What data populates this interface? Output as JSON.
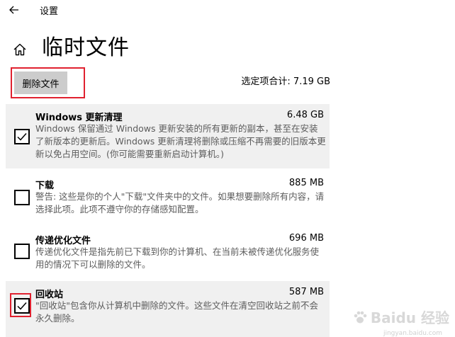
{
  "titlebar": {
    "app_title": "设置"
  },
  "page": {
    "title": "临时文件",
    "delete_button_label": "删除文件",
    "selected_total": "选定项合计: 7.19 GB"
  },
  "categories": [
    {
      "name": "Windows 更新清理",
      "size": "6.48 GB",
      "description": "Windows 保留通过 Windows 更新安装的所有更新的副本，甚至在安装了新版本的更新后。Windows 更新清理将删除或压缩不再需要的旧版本更新以免占用空间。(你可能需要重新启动计算机。)",
      "checked": true
    },
    {
      "name": "下载",
      "size": "885 MB",
      "description": "警告: 这些是你的个人\"下载\"文件夹中的文件。如果想要删除所有内容，请选择此项。此项不遵守你的存储感知配置。",
      "checked": false
    },
    {
      "name": "传递优化文件",
      "size": "696 MB",
      "description": "传递优化文件是指先前已下载到你的计算机、在当前未被传递优化服务使用的情况下可以删除的文件。",
      "checked": false
    },
    {
      "name": "回收站",
      "size": "587 MB",
      "description": "\"回收站\"包含你从计算机中删除的文件。这些文件在清空回收站之前不会永久删除。",
      "checked": true
    }
  ],
  "watermark": {
    "text": "Baidu 经验",
    "sub": "jingyan.baidu.com"
  },
  "colors": {
    "highlight_red": "#e0212f",
    "button_gray": "#cccccc",
    "selected_row_bg": "#f0f0f0",
    "description_gray": "#5c5c5c"
  },
  "icons": {
    "back": "back-arrow-icon",
    "home": "home-icon",
    "check": "checkmark-icon"
  }
}
